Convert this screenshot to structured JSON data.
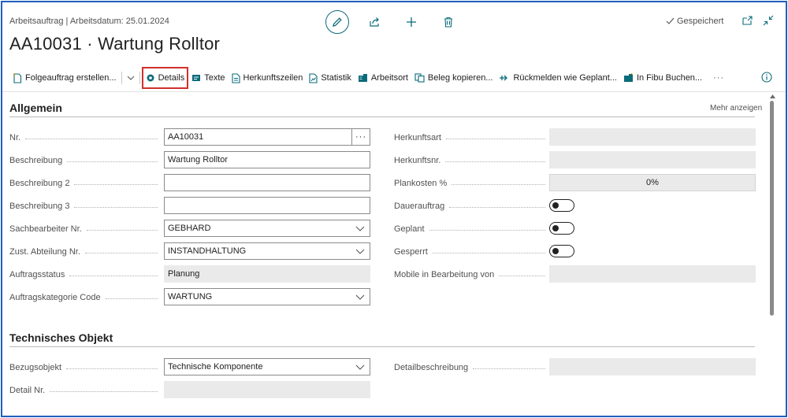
{
  "header": {
    "caption": "Arbeitsauftrag | Arbeitsdatum: 25.01.2024",
    "title": "AA10031 · Wartung Rolltor",
    "status": "Gespeichert",
    "icons": [
      "pencil-icon",
      "share-icon",
      "plus-icon",
      "trash-icon",
      "open-new-window-icon",
      "collapse-icon"
    ]
  },
  "actions": {
    "followup": "Folgeauftrag erstellen...",
    "details": "Details",
    "texts": "Texte",
    "origin_lines": "Herkunftszeilen",
    "statistics": "Statistik",
    "work_location": "Arbeitsort",
    "copy_document": "Beleg kopieren...",
    "report_as_planned": "Rückmelden wie Geplant...",
    "post_fibu": "In Fibu Buchen...",
    "more": "···"
  },
  "general": {
    "title": "Allgemein",
    "show_more": "Mehr anzeigen",
    "no_label": "Nr.",
    "no_value": "AA10031",
    "lookup": "···",
    "desc_label": "Beschreibung",
    "desc_value": "Wartung Rolltor",
    "desc2_label": "Beschreibung 2",
    "desc2_value": "",
    "desc3_label": "Beschreibung 3",
    "desc3_value": "",
    "clerk_label": "Sachbearbeiter Nr.",
    "clerk_value": "GEBHARD",
    "dept_label": "Zust. Abteilung Nr.",
    "dept_value": "INSTANDHALTUNG",
    "status_label": "Auftragsstatus",
    "status_value": "Planung",
    "category_label": "Auftragskategorie Code",
    "category_value": "WARTUNG",
    "origin_type_label": "Herkunftsart",
    "origin_type_value": "",
    "origin_no_label": "Herkunftsnr.",
    "origin_no_value": "",
    "plan_cost_label": "Plankosten %",
    "plan_cost_value": "0%",
    "recurring_label": "Dauerauftrag",
    "recurring_on": false,
    "planned_label": "Geplant",
    "planned_on": false,
    "blocked_label": "Gesperrt",
    "blocked_on": false,
    "mobile_label": "Mobile in Bearbeitung von",
    "mobile_value": ""
  },
  "technical": {
    "title": "Technisches Objekt",
    "ref_label": "Bezugsobjekt",
    "ref_value": "Technische Komponente",
    "detail_no_label": "Detail Nr.",
    "detail_no_value": "",
    "detail_desc_label": "Detailbeschreibung",
    "detail_desc_value": ""
  },
  "colors": {
    "accent": "#0b6b7a",
    "frame": "#1f5fbf",
    "highlight": "#d0312d"
  }
}
